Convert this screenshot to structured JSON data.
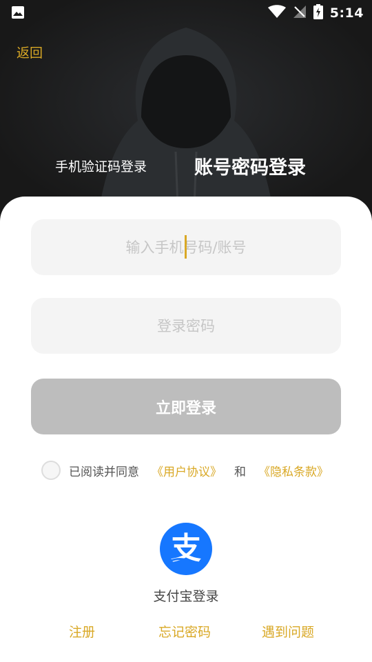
{
  "status_bar": {
    "time": "5:14"
  },
  "header": {
    "back_label": "返回"
  },
  "tabs": {
    "sms_login": "手机验证码登录",
    "password_login": "账号密码登录"
  },
  "form": {
    "phone_placeholder": "输入手机号码/账号",
    "phone_value": "",
    "password_placeholder": "登录密码",
    "password_value": "",
    "submit_label": "立即登录"
  },
  "agreement": {
    "prefix": "已阅读并同意",
    "user_agreement": "《用户协议》",
    "and": "和",
    "privacy_policy": "《隐私条款》"
  },
  "alipay": {
    "label": "支付宝登录",
    "logo_glyph": "支"
  },
  "footer": {
    "register": "注册",
    "forgot_password": "忘记密码",
    "problem": "遇到问题"
  },
  "colors": {
    "accent": "#d9a825",
    "alipay_blue": "#1677ff",
    "button_disabled": "#bdbdbd",
    "input_bg": "#f4f4f4"
  }
}
